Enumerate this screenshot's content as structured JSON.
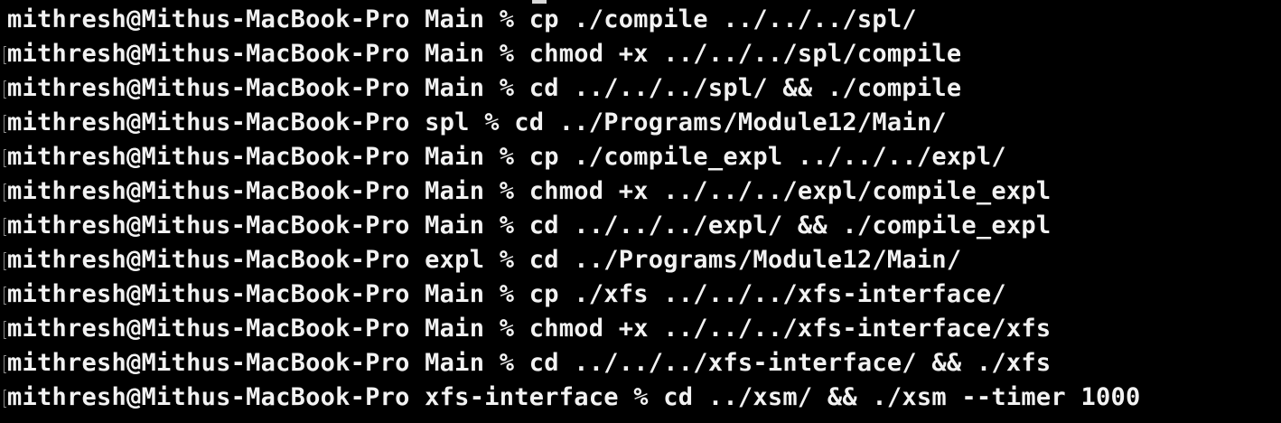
{
  "terminal": {
    "lines": [
      {
        "user_host": "mithresh@Mithus-MacBook-Pro",
        "dir": "Main",
        "prompt": "%",
        "command": "cp ./compile ../../../spl/"
      },
      {
        "user_host": "mithresh@Mithus-MacBook-Pro",
        "dir": "Main",
        "prompt": "%",
        "command": "chmod +x ../../../spl/compile"
      },
      {
        "user_host": "mithresh@Mithus-MacBook-Pro",
        "dir": "Main",
        "prompt": "%",
        "command": "cd ../../../spl/ && ./compile"
      },
      {
        "user_host": "mithresh@Mithus-MacBook-Pro",
        "dir": "spl",
        "prompt": "%",
        "command": "cd ../Programs/Module12/Main/"
      },
      {
        "user_host": "mithresh@Mithus-MacBook-Pro",
        "dir": "Main",
        "prompt": "%",
        "command": "cp ./compile_expl ../../../expl/"
      },
      {
        "user_host": "mithresh@Mithus-MacBook-Pro",
        "dir": "Main",
        "prompt": "%",
        "command": "chmod +x ../../../expl/compile_expl"
      },
      {
        "user_host": "mithresh@Mithus-MacBook-Pro",
        "dir": "Main",
        "prompt": "%",
        "command": "cd ../../../expl/ && ./compile_expl"
      },
      {
        "user_host": "mithresh@Mithus-MacBook-Pro",
        "dir": "expl",
        "prompt": "%",
        "command": "cd ../Programs/Module12/Main/"
      },
      {
        "user_host": "mithresh@Mithus-MacBook-Pro",
        "dir": "Main",
        "prompt": "%",
        "command": "cp ./xfs ../../../xfs-interface/"
      },
      {
        "user_host": "mithresh@Mithus-MacBook-Pro",
        "dir": "Main",
        "prompt": "%",
        "command": "chmod +x ../../../xfs-interface/xfs"
      },
      {
        "user_host": "mithresh@Mithus-MacBook-Pro",
        "dir": "Main",
        "prompt": "%",
        "command": "cd ../../../xfs-interface/ && ./xfs"
      },
      {
        "user_host": "mithresh@Mithus-MacBook-Pro",
        "dir": "xfs-interface",
        "prompt": "%",
        "command": "cd ../xsm/ && ./xsm --timer 1000"
      }
    ]
  },
  "colors": {
    "background": "#000000",
    "text": "#f2f2f2",
    "mark_bracket": "#8a8a8a"
  }
}
